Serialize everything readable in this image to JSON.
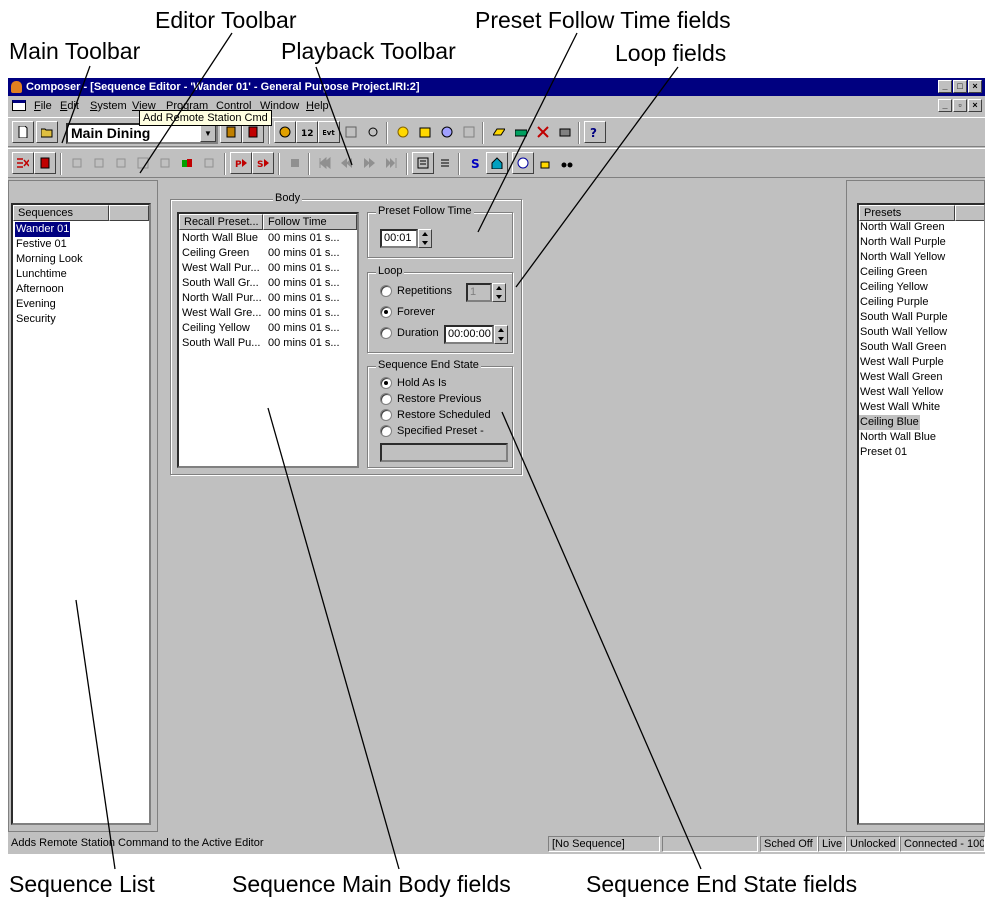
{
  "callouts": {
    "editor_toolbar": "Editor Toolbar",
    "preset_follow_time_fields": "Preset Follow Time fields",
    "main_toolbar": "Main Toolbar",
    "playback_toolbar": "Playback Toolbar",
    "loop_fields": "Loop fields",
    "sequence_list": "Sequence List",
    "sequence_main_body_fields": "Sequence Main Body fields",
    "sequence_end_state_fields": "Sequence End State fields"
  },
  "window": {
    "title": "Composer - [Sequence Editor - 'Wander 01' - General Purpose Project.IRI:2]"
  },
  "menu": [
    "File",
    "Edit",
    "System",
    "View",
    "Program",
    "Control",
    "Window",
    "Help"
  ],
  "main_toolbar": {
    "room_select": "Main Dining"
  },
  "tooltip": "Add Remote Station Cmd",
  "sequences": {
    "header": "Sequences",
    "items": [
      "Wander 01",
      "Festive 01",
      "Morning Look",
      "Lunchtime",
      "Afternoon",
      "Evening",
      "Security"
    ],
    "selected": "Wander 01"
  },
  "main_body": {
    "group_label": "Body",
    "col_recall": "Recall Preset...",
    "col_follow": "Follow Time",
    "rows": [
      {
        "preset": "North Wall Blue",
        "time": "00 mins 01 s..."
      },
      {
        "preset": "Ceiling Green",
        "time": "00 mins 01 s..."
      },
      {
        "preset": "West Wall Pur...",
        "time": "00 mins 01 s..."
      },
      {
        "preset": "South Wall Gr...",
        "time": "00 mins 01 s..."
      },
      {
        "preset": "North Wall Pur...",
        "time": "00 mins 01 s..."
      },
      {
        "preset": "West Wall Gre...",
        "time": "00 mins 01 s..."
      },
      {
        "preset": "Ceiling Yellow",
        "time": "00 mins 01 s..."
      },
      {
        "preset": "South Wall Pu...",
        "time": "00 mins 01 s..."
      }
    ]
  },
  "preset_follow_time": {
    "label": "Preset Follow Time",
    "value": "00:01"
  },
  "loop": {
    "label": "Loop",
    "repetitions_label": "Repetitions",
    "repetitions_value": "1",
    "forever_label": "Forever",
    "duration_label": "Duration",
    "duration_value": "00:00:00",
    "selected": "Forever"
  },
  "end_state": {
    "label": "Sequence End State",
    "options": [
      "Hold As Is",
      "Restore Previous",
      "Restore Scheduled",
      "Specified Preset -"
    ],
    "selected": "Hold As Is",
    "specified_value": ""
  },
  "presets": {
    "header": "Presets",
    "items": [
      "North Wall Green",
      "North Wall Purple",
      "North Wall Yellow",
      "Ceiling Green",
      "Ceiling Yellow",
      "Ceiling Purple",
      "South Wall Purple",
      "South Wall Yellow",
      "South Wall Green",
      "West Wall Purple",
      "West Wall Green",
      "West Wall Yellow",
      "West Wall White",
      "Ceiling Blue",
      "North Wall Blue",
      "Preset 01"
    ],
    "highlighted": "Ceiling Blue"
  },
  "status": {
    "message": "Adds Remote Station Command to the Active Editor",
    "sequence": "[No Sequence]",
    "sched": "Sched Off",
    "live": "Live",
    "lock": "Unlocked",
    "connection": "Connected - 100"
  },
  "colors": {
    "title_bar": "#000080",
    "chrome": "#c0c0c0",
    "selection": "#000080",
    "tooltip_bg": "#ffffe1"
  }
}
